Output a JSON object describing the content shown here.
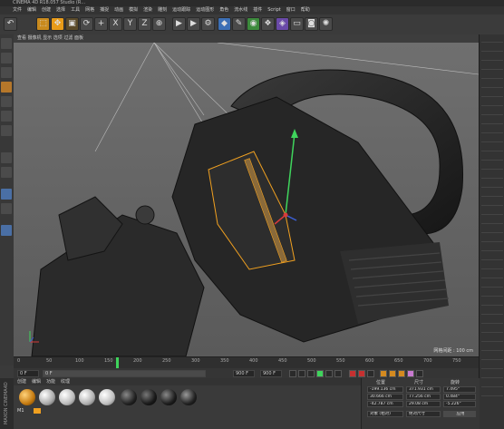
{
  "app": {
    "title": "CINEMA 4D R18.057 Studio (R…"
  },
  "menu": {
    "items": [
      "文件",
      "编辑",
      "创建",
      "选择",
      "工具",
      "网格",
      "捕捉",
      "动画",
      "模拟",
      "渲染",
      "雕刻",
      "运动跟踪",
      "运动图形",
      "角色",
      "流水线",
      "插件",
      "Script",
      "窗口",
      "帮助"
    ]
  },
  "viewport": {
    "menu": "查看 摄像机 显示 选项 过滤 面板",
    "grid_label": "网格间距 : 100 cm"
  },
  "timeline": {
    "ticks": [
      "0",
      "50",
      "100",
      "150",
      "200",
      "250",
      "300",
      "350",
      "400",
      "450",
      "500",
      "550",
      "600",
      "650",
      "700",
      "750"
    ],
    "current_frame": "0 F",
    "start_field": "0 F",
    "end_field": "900 F",
    "max_field": "900 F",
    "progress": 0.22
  },
  "materials": {
    "menu": [
      "创建",
      "编辑",
      "功能",
      "纹理"
    ],
    "label": "M1"
  },
  "attributes": {
    "headers": [
      "位置",
      "尺寸",
      "旋转"
    ],
    "position": [
      "-199.136 cm",
      "30.666 cm",
      "-42.787 cm"
    ],
    "size": [
      "371.931 cm",
      "77.256 cm",
      "29.08 cm"
    ],
    "rotation": [
      "7.495°",
      "0.484°",
      "-5.226°"
    ],
    "mode": "对象 (相对)",
    "size_mode": "绝对尺寸",
    "apply": "应用"
  },
  "brand": "MAXON CINEMA4D",
  "colors": {
    "accent": "#f0a020",
    "viewport_bg": "#676767",
    "play_green": "#3fd45c"
  }
}
